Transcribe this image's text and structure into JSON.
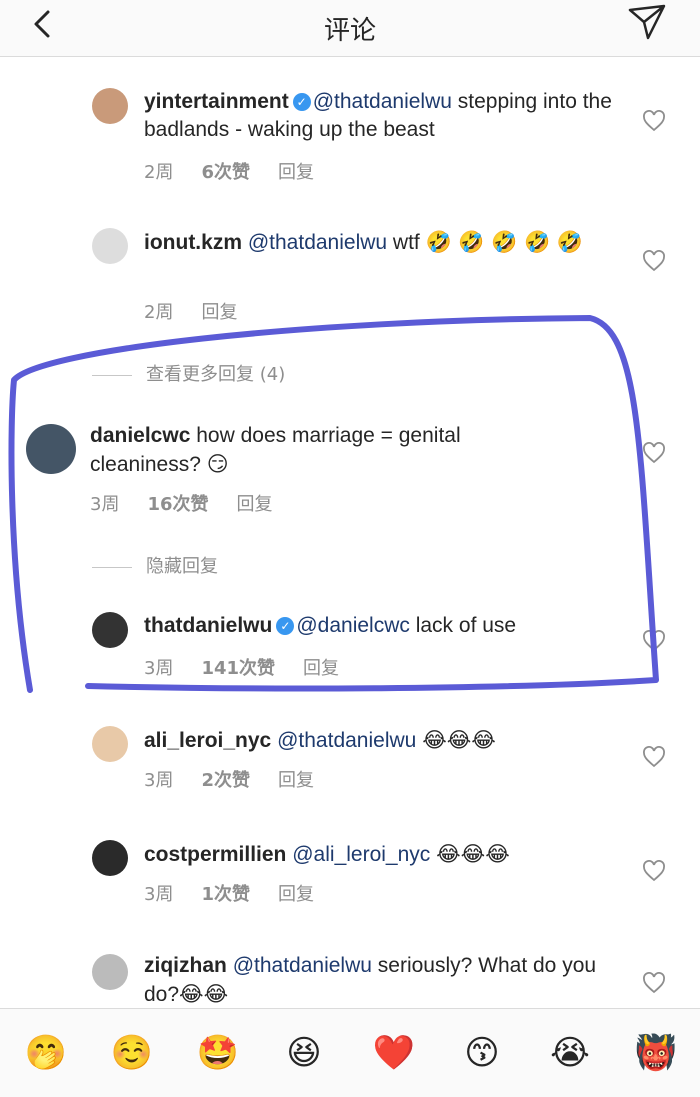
{
  "header": {
    "title": "评论"
  },
  "comments": [
    {
      "username": "yintertainment",
      "verified": true,
      "mention": "@thatdanielwu",
      "text": " stepping into the badlands - waking up the beast",
      "time": "2周",
      "likes": "6次赞",
      "reply": "回复"
    },
    {
      "username": "ionut.kzm",
      "mention": "@thatdanielwu",
      "text": " wtf",
      "emoji": "🤣 🤣 🤣 🤣 🤣",
      "time": "2周",
      "reply": "回复"
    },
    {
      "username": "danielcwc",
      "text": " how does marriage = genital cleaniness?",
      "emoji": "😏",
      "time": "3周",
      "likes": "16次赞",
      "reply": "回复"
    },
    {
      "username": "thatdanielwu",
      "verified": true,
      "mention": "@danielcwc",
      "text": " lack of use",
      "time": "3周",
      "likes": "141次赞",
      "reply": "回复"
    },
    {
      "username": "ali_leroi_nyc",
      "mention": "@thatdanielwu",
      "emoji": "😂😂😂",
      "time": "3周",
      "likes": "2次赞",
      "reply": "回复"
    },
    {
      "username": "costpermillien",
      "mention": "@ali_leroi_nyc",
      "emoji": "😂😂😂",
      "time": "3周",
      "likes": "1次赞",
      "reply": "回复"
    },
    {
      "username": "ziqizhan",
      "mention": "@thatdanielwu",
      "text": " seriously? What do you do?",
      "emoji": "😂😂"
    }
  ],
  "view_more_replies": "查看更多回复 (4)",
  "hide_replies": "隐藏回复",
  "reactions": [
    "🤭",
    "☺️",
    "🤩",
    "😆",
    "❤️",
    "😙",
    "😭",
    "👹"
  ],
  "colors": {
    "link": "#1e3a6d",
    "highlight": "#5b5bd6",
    "verified": "#3897f0"
  }
}
